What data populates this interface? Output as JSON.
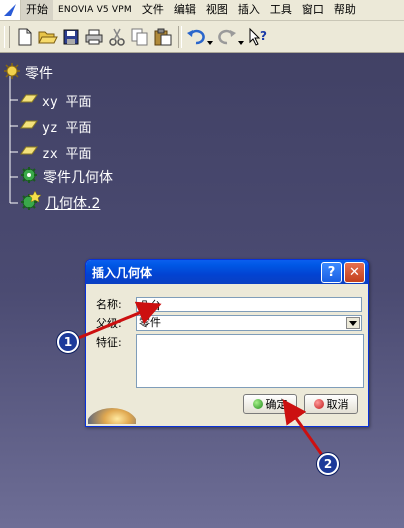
{
  "menu": {
    "items": [
      "开始",
      "ENOVIA V5 VPM",
      "文件",
      "编辑",
      "视图",
      "插入",
      "工具",
      "窗口",
      "帮助"
    ]
  },
  "toolbar": {
    "icons": [
      "new-icon",
      "open-icon",
      "save-icon",
      "print-icon",
      "cut-icon",
      "copy-icon",
      "paste-icon",
      "undo-icon",
      "redo-icon",
      "whats-this-icon"
    ]
  },
  "tree": {
    "root": "零件",
    "items": [
      {
        "label": "xy 平面",
        "icon": "plane-icon"
      },
      {
        "label": "yz 平面",
        "icon": "plane-icon"
      },
      {
        "label": "zx 平面",
        "icon": "plane-icon"
      },
      {
        "label": "零件几何体",
        "icon": "body-icon"
      },
      {
        "label": "几何体.2",
        "icon": "body-icon"
      }
    ]
  },
  "dialog": {
    "title": "插入几何体",
    "help_button": "?",
    "close_button": "✕",
    "name_label": "名称:",
    "name_value": "凸台",
    "parent_label": "父级:",
    "parent_value": "零件",
    "features_label": "特征:",
    "ok_label": "确定",
    "cancel_label": "取消"
  },
  "callouts": [
    "1",
    "2"
  ],
  "colors": {
    "background": "#4b4b72",
    "titlebar": "#0243d2",
    "callout": "#1c3a9a",
    "arrow": "#cc1010"
  }
}
